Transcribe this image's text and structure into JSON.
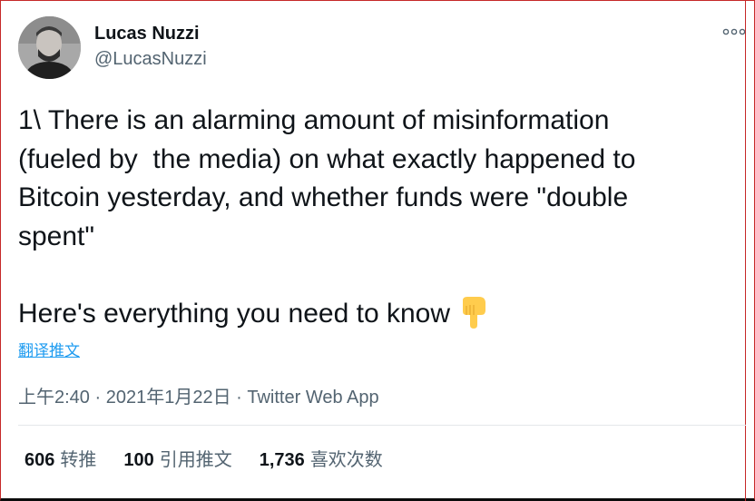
{
  "user": {
    "name": "Lucas Nuzzi",
    "handle": "@LucasNuzzi"
  },
  "tweet": {
    "text": "1\\ There is an alarming amount of misinformation\n(fueled by  the media) on what exactly happened to\nBitcoin yesterday, and whether funds were \"double\nspent\"\n\nHere's everything you need to know ",
    "emoji": "pointing-down-hand-icon",
    "translate_label": "翻译推文",
    "time": "上午2:40",
    "date": "2021年1月22日",
    "source": "Twitter Web App",
    "sep": " · "
  },
  "stats": {
    "retweets": "606",
    "retweets_label": "转推",
    "quotes": "100",
    "quotes_label": "引用推文",
    "likes": "1,736",
    "likes_label": "喜欢次数"
  },
  "colors": {
    "accent": "#1d9bf0",
    "muted": "#536471",
    "frame": "#c62828"
  }
}
